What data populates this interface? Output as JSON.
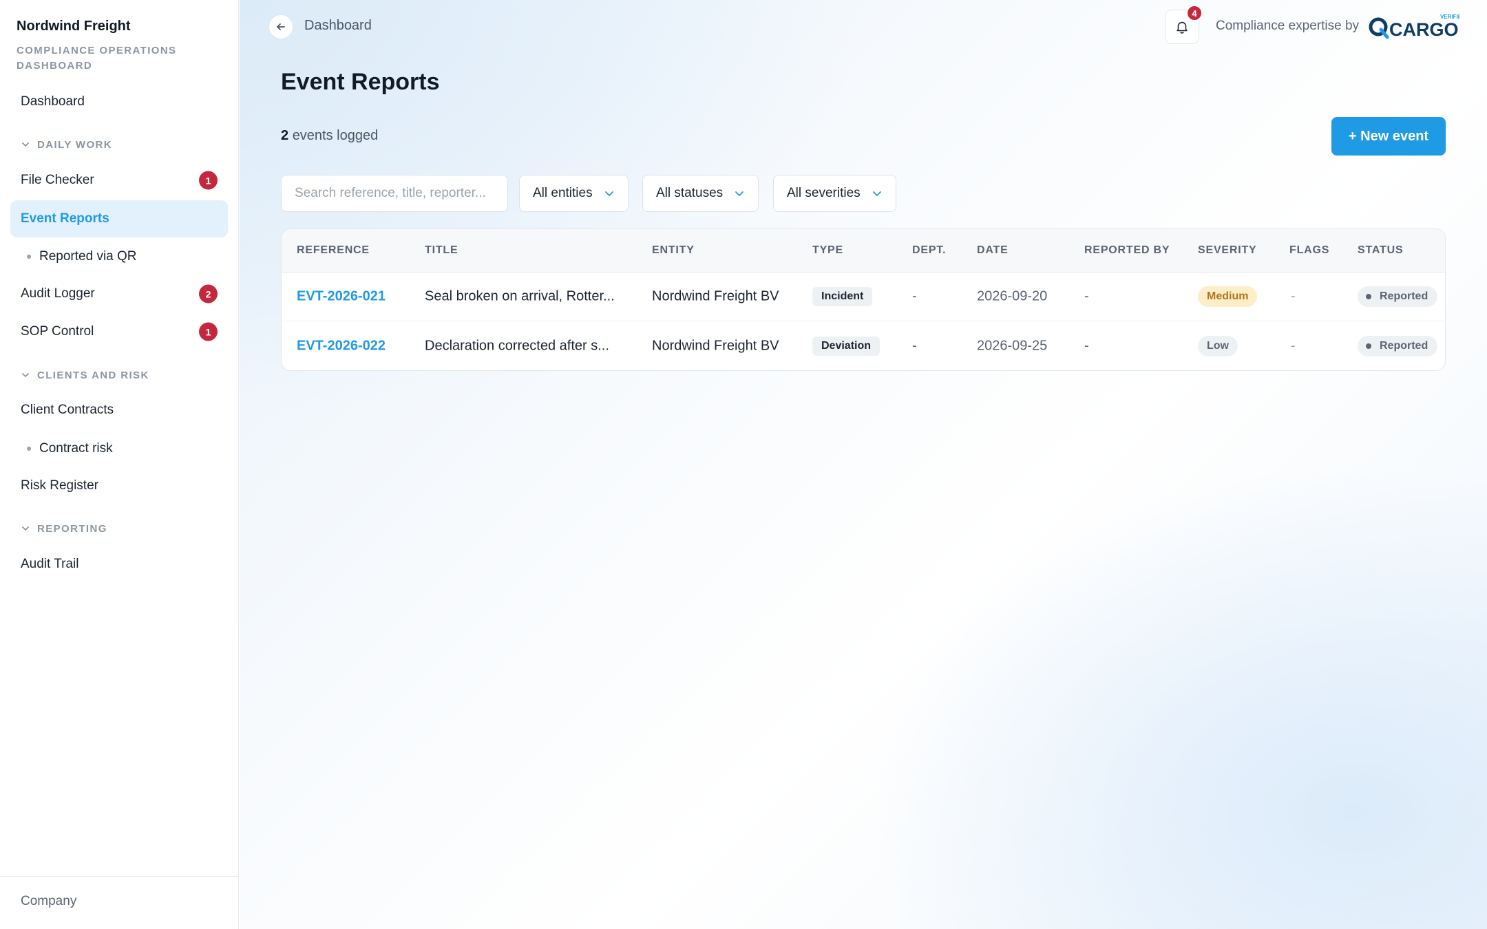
{
  "sidebar": {
    "brand_name": "Nordwind Freight",
    "brand_sub": "Compliance Operations Dashboard",
    "dashboard": "Dashboard",
    "sections": {
      "daily_work": "Daily Work",
      "clients_risk": "Clients and Risk",
      "reporting": "Reporting"
    },
    "items": {
      "file_checker": {
        "label": "File Checker",
        "badge": "1"
      },
      "event_reports": {
        "label": "Event Reports"
      },
      "reported_qr": {
        "label": "Reported via QR"
      },
      "audit_logger": {
        "label": "Audit Logger",
        "badge": "2"
      },
      "sop_control": {
        "label": "SOP Control",
        "badge": "1"
      },
      "client_contracts": {
        "label": "Client Contracts"
      },
      "contract_risk": {
        "label": "Contract risk"
      },
      "risk_register": {
        "label": "Risk Register"
      },
      "audit_trail": {
        "label": "Audit Trail"
      }
    },
    "footer": "Company"
  },
  "header": {
    "breadcrumb": "Dashboard",
    "notifications_count": "4",
    "expertise_text": "Compliance expertise by",
    "logo_text": "CARGO",
    "logo_tag": "VERIFIED"
  },
  "page": {
    "title": "Event Reports",
    "count": "2",
    "count_suffix": "events logged",
    "new_button": "+ New event"
  },
  "filters": {
    "search_placeholder": "Search reference, title, reporter...",
    "entities": "All entities",
    "statuses": "All statuses",
    "severities": "All severities"
  },
  "table": {
    "columns": [
      "Reference",
      "Title",
      "Entity",
      "Type",
      "Dept.",
      "Date",
      "Reported by",
      "Severity",
      "Flags",
      "Status"
    ],
    "rows": [
      {
        "reference": "EVT-2026-021",
        "title": "Seal broken on arrival, Rotter...",
        "entity": "Nordwind Freight BV",
        "type": "Incident",
        "dept": "-",
        "date": "2026-09-20",
        "reported_by": "-",
        "severity": "Medium",
        "flags": "-",
        "status": "Reported"
      },
      {
        "reference": "EVT-2026-022",
        "title": "Declaration corrected after s...",
        "entity": "Nordwind Freight BV",
        "type": "Deviation",
        "dept": "-",
        "date": "2026-09-25",
        "reported_by": "-",
        "severity": "Low",
        "flags": "-",
        "status": "Reported"
      }
    ]
  },
  "colors": {
    "accent": "#1f9ae5",
    "badge_red": "#c5283d",
    "severity_medium_bg": "#fdeec9",
    "severity_medium_fg": "#b0751a"
  }
}
